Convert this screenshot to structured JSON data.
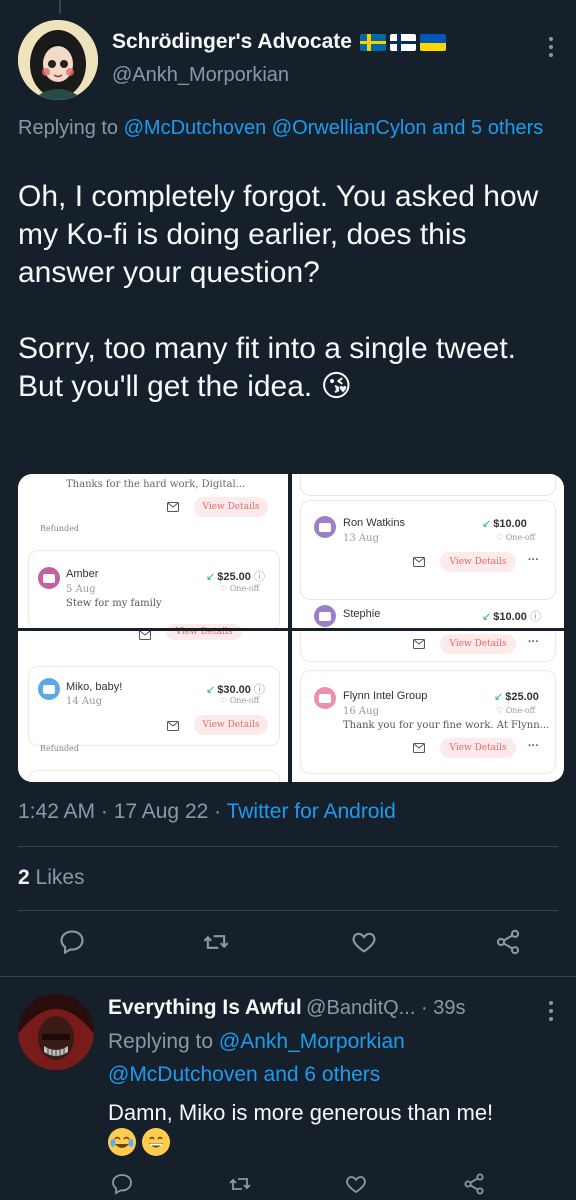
{
  "main_tweet": {
    "display_name": "Schrödinger's Advocate",
    "handle": "@Ankh_Morporkian",
    "replying_prefix": "Replying to ",
    "replying_mentions": "@McDutchoven @OrwellianCylon and 5 others",
    "text": "Oh, I completely forgot. You asked how my Ko-fi is doing earlier, does this answer your question?\n\nSorry, too many fit into a single tweet. But you'll get the idea. 😘",
    "timestamp": "1:42 AM · 17 Aug 22 · ",
    "source": "Twitter for Android",
    "likes_count": "2",
    "likes_label": " Likes",
    "flags": [
      "sweden",
      "finland",
      "ukraine"
    ]
  },
  "media": {
    "q1": {
      "top_msg": "Thanks for the hard work, Digital...",
      "view_details": "View Details",
      "refunded": "Refunded",
      "donor": "Amber",
      "date": "5 Aug",
      "msg": "Stew for my family",
      "amount": "$25.00",
      "oneoff": "One-off"
    },
    "q1b": {
      "view_details": "View Details"
    },
    "q2": {
      "donor": "Ron Watkins",
      "date": "13 Aug",
      "amount": "$10.00",
      "oneoff": "One-off",
      "view_details": "View Details",
      "donor2": "Stephie",
      "amount2": "$10.00"
    },
    "q2b": {
      "view_details": "View Details"
    },
    "q3": {
      "donor": "Miko, baby!",
      "date": "14 Aug",
      "amount": "$30.00",
      "oneoff": "One-off",
      "view_details": "View Details",
      "refunded": "Refunded"
    },
    "q4": {
      "donor": "Flynn Intel Group",
      "date": "16 Aug",
      "msg": "Thank you for your fine work. At Flynn...",
      "amount": "$25.00",
      "oneoff": "One-off",
      "view_details": "View Details"
    }
  },
  "reply_tweet": {
    "display_name": "Everything Is Awful",
    "handle": "@BanditQ...",
    "time": " · 39s",
    "replying_prefix": "Replying to ",
    "replying_mentions_line1": "@Ankh_Morporkian",
    "replying_mentions_line2": "@McDutchoven and 6 others",
    "text": "Damn, Miko is more generous than me!"
  },
  "icons": [
    "more-vertical-icon",
    "reply-icon",
    "retweet-icon",
    "like-icon",
    "share-icon",
    "info-icon",
    "mail-icon",
    "heart-icon"
  ],
  "colors": {
    "background": "#15202b",
    "accent": "#1d9bf0",
    "muted": "#8b98a5",
    "text": "#f7f9f9"
  }
}
